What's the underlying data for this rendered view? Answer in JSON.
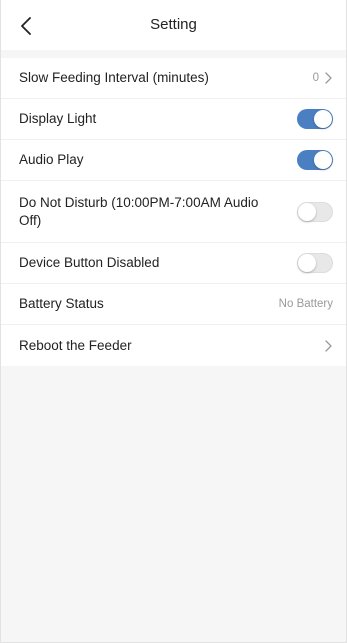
{
  "header": {
    "title": "Setting",
    "back_icon": "chevron-left-icon"
  },
  "settings": [
    {
      "id": "slow-feeding-interval",
      "label": "Slow Feeding Interval (minutes)",
      "type": "value-nav",
      "value": "0"
    },
    {
      "id": "display-light",
      "label": "Display Light",
      "type": "toggle",
      "on": true
    },
    {
      "id": "audio-play",
      "label": "Audio Play",
      "type": "toggle",
      "on": true
    },
    {
      "id": "do-not-disturb",
      "label": "Do Not Disturb (10:00PM-7:00AM Audio Off)",
      "type": "toggle",
      "on": false
    },
    {
      "id": "device-button-disabled",
      "label": "Device Button Disabled",
      "type": "toggle",
      "on": false
    },
    {
      "id": "battery-status",
      "label": "Battery Status",
      "type": "value",
      "value": "No Battery"
    },
    {
      "id": "reboot-feeder",
      "label": "Reboot the Feeder",
      "type": "nav"
    }
  ],
  "colors": {
    "toggle_on": "#4a7fc2",
    "toggle_off": "#e8e8e8",
    "background": "#f6f6f6"
  }
}
